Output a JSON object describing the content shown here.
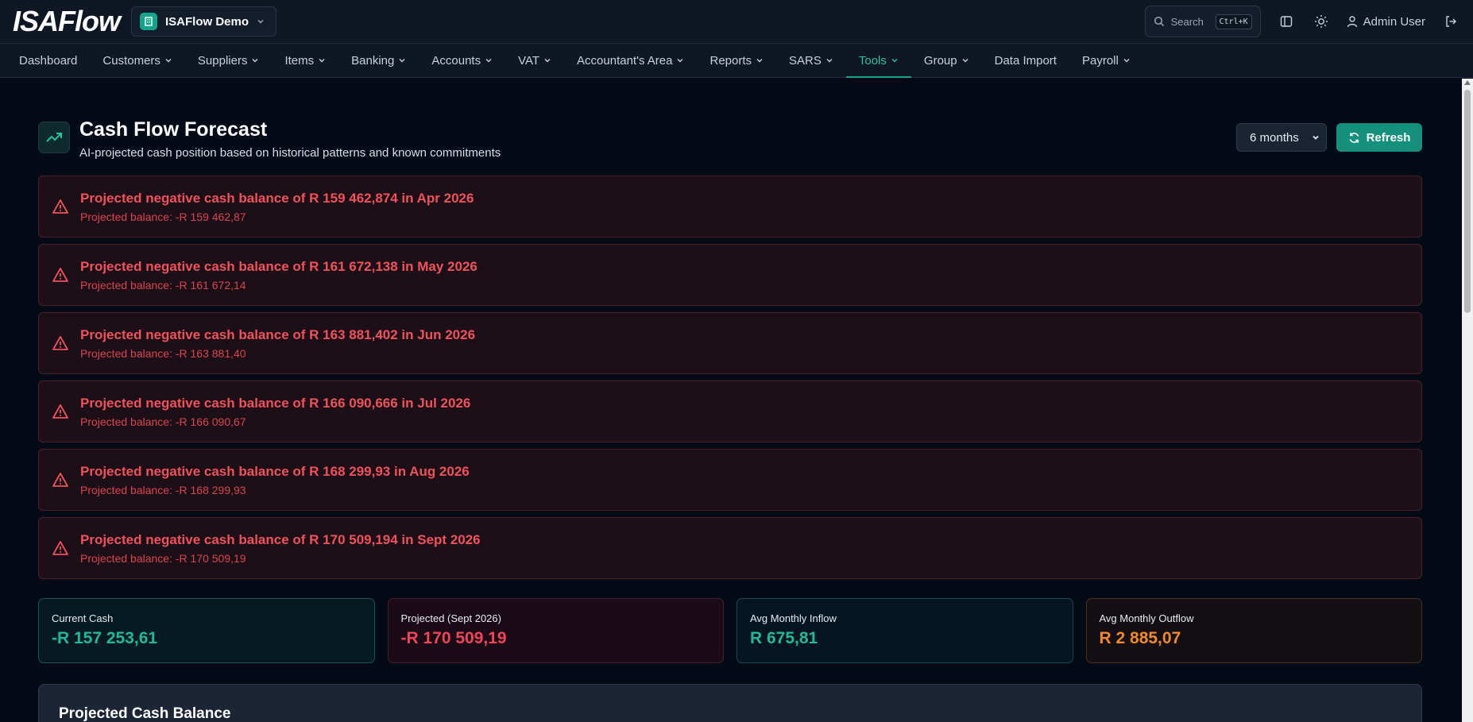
{
  "app": {
    "logo": "ISAFlow",
    "company": "ISAFlow Demo",
    "search_label": "Search",
    "search_shortcut": "Ctrl+K",
    "user": "Admin User"
  },
  "nav": {
    "items": [
      {
        "label": "Dashboard",
        "dropdown": false,
        "active": false
      },
      {
        "label": "Customers",
        "dropdown": true,
        "active": false
      },
      {
        "label": "Suppliers",
        "dropdown": true,
        "active": false
      },
      {
        "label": "Items",
        "dropdown": true,
        "active": false
      },
      {
        "label": "Banking",
        "dropdown": true,
        "active": false
      },
      {
        "label": "Accounts",
        "dropdown": true,
        "active": false
      },
      {
        "label": "VAT",
        "dropdown": true,
        "active": false
      },
      {
        "label": "Accountant's Area",
        "dropdown": true,
        "active": false
      },
      {
        "label": "Reports",
        "dropdown": true,
        "active": false
      },
      {
        "label": "SARS",
        "dropdown": true,
        "active": false
      },
      {
        "label": "Tools",
        "dropdown": true,
        "active": true
      },
      {
        "label": "Group",
        "dropdown": true,
        "active": false
      },
      {
        "label": "Data Import",
        "dropdown": false,
        "active": false
      },
      {
        "label": "Payroll",
        "dropdown": true,
        "active": false
      }
    ]
  },
  "page": {
    "title": "Cash Flow Forecast",
    "subtitle": "AI-projected cash position based on historical patterns and known commitments",
    "period_select": "6 months",
    "refresh_label": "Refresh"
  },
  "alerts": [
    {
      "title": "Projected negative cash balance of R 159 462,874 in Apr 2026",
      "detail": "Projected balance: -R 159 462,87"
    },
    {
      "title": "Projected negative cash balance of R 161 672,138 in May 2026",
      "detail": "Projected balance: -R 161 672,14"
    },
    {
      "title": "Projected negative cash balance of R 163 881,402 in Jun 2026",
      "detail": "Projected balance: -R 163 881,40"
    },
    {
      "title": "Projected negative cash balance of R 166 090,666 in Jul 2026",
      "detail": "Projected balance: -R 166 090,67"
    },
    {
      "title": "Projected negative cash balance of R 168 299,93 in Aug 2026",
      "detail": "Projected balance: -R 168 299,93"
    },
    {
      "title": "Projected negative cash balance of R 170 509,194 in Sept 2026",
      "detail": "Projected balance: -R 170 509,19"
    }
  ],
  "stats": [
    {
      "label": "Current Cash",
      "value": "-R 157 253,61",
      "tone": "teal"
    },
    {
      "label": "Projected (Sept 2026)",
      "value": "-R 170 509,19",
      "tone": "red"
    },
    {
      "label": "Avg Monthly Inflow",
      "value": "R 675,81",
      "tone": "blue"
    },
    {
      "label": "Avg Monthly Outflow",
      "value": "R 2 885,07",
      "tone": "orange"
    }
  ],
  "chart_card": {
    "title": "Projected Cash Balance"
  },
  "colors": {
    "accent": "#14a38b",
    "danger": "#f0525c",
    "warning": "#f08a24"
  }
}
